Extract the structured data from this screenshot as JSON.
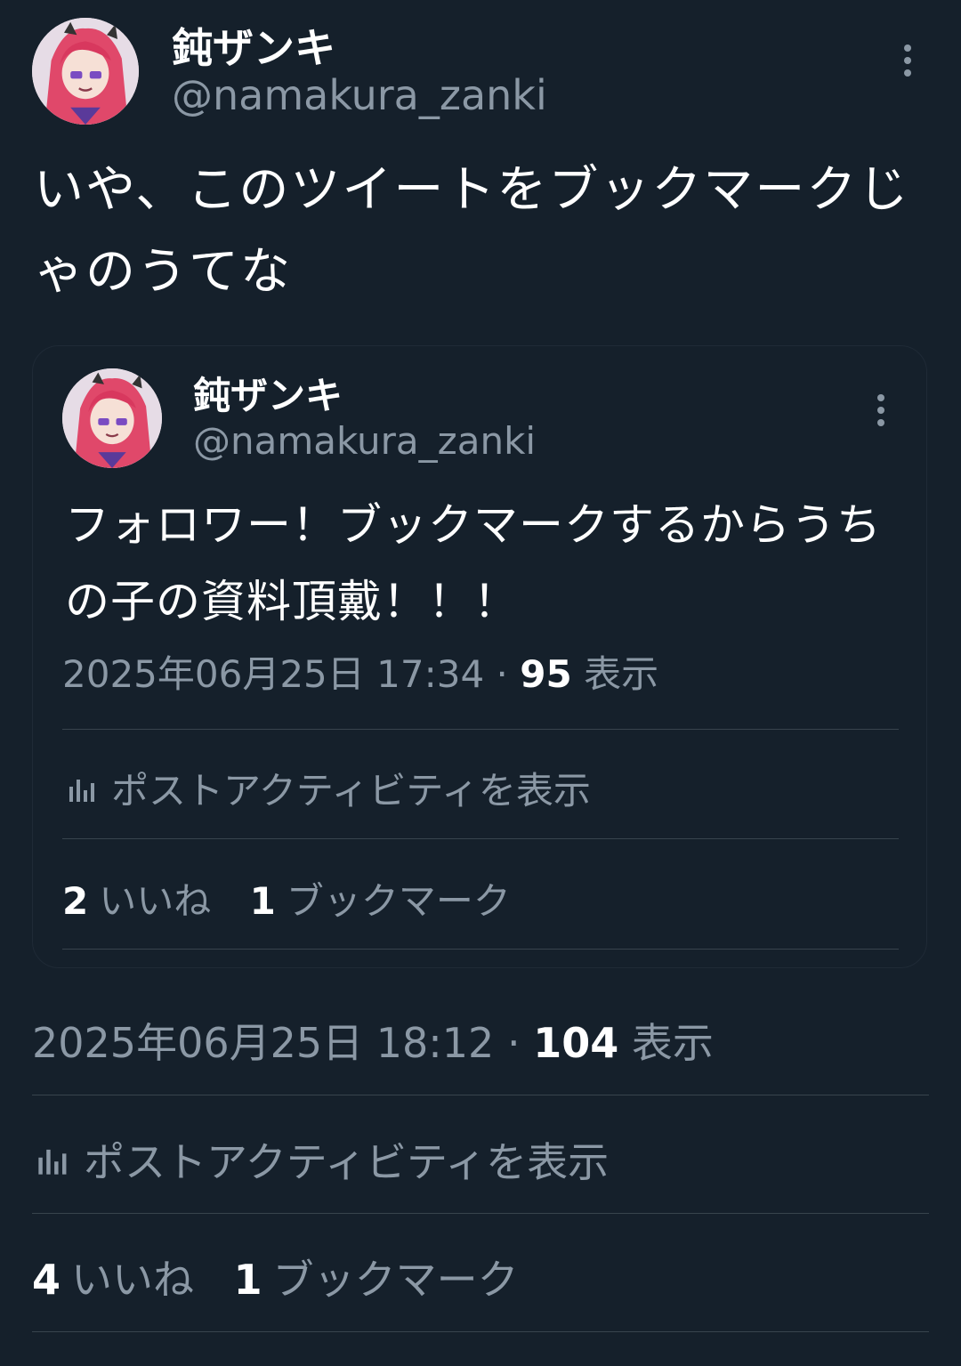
{
  "colors": {
    "background": "#15202b",
    "text_primary": "#ffffff",
    "text_secondary": "#8b98a5",
    "divider": "#38444d"
  },
  "tweet": {
    "author": {
      "display_name": "鈍ザンキ",
      "handle": "@namakura_zanki",
      "avatar_icon": "avatar-anime-character"
    },
    "text": "いや、このツイートをブックマークじゃのうてな",
    "timestamp": "2025年06月25日 18:12",
    "separator": "·",
    "views_count": "104",
    "views_label": "表示",
    "activity_label": "ポストアクティビティを表示",
    "likes_count": "4",
    "likes_label": "いいね",
    "bookmarks_count": "1",
    "bookmarks_label": "ブックマーク"
  },
  "quoted": {
    "author": {
      "display_name": "鈍ザンキ",
      "handle": "@namakura_zanki",
      "avatar_icon": "avatar-anime-character"
    },
    "text": "フォロワー！ブックマークするからうちの子の資料頂戴！！！",
    "timestamp": "2025年06月25日 17:34",
    "separator": "·",
    "views_count": "95",
    "views_label": "表示",
    "activity_label": "ポストアクティビティを表示",
    "likes_count": "2",
    "likes_label": "いいね",
    "bookmarks_count": "1",
    "bookmarks_label": "ブックマーク"
  }
}
